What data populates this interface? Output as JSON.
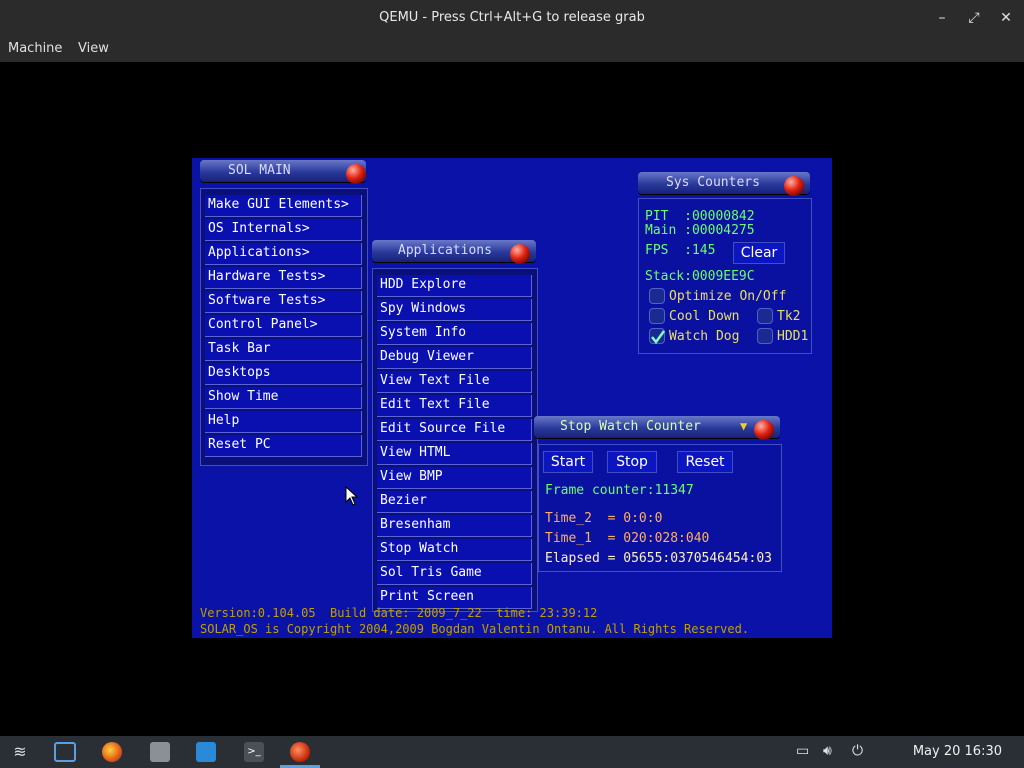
{
  "window": {
    "title": "QEMU - Press Ctrl+Alt+G to release grab",
    "menu": [
      "Machine",
      "View"
    ]
  },
  "sol_main": {
    "title": "SOL MAIN",
    "items": [
      "Make GUI Elements>",
      "OS Internals>",
      "Applications>",
      "Hardware Tests>",
      "Software Tests>",
      "Control Panel>",
      "Task Bar",
      "Desktops",
      "Show Time",
      "Help",
      "Reset PC"
    ]
  },
  "applications": {
    "title": "Applications",
    "items": [
      "HDD Explore",
      "Spy Windows",
      "System Info",
      "Debug Viewer",
      "View Text File",
      "Edit Text File",
      "Edit Source File",
      "View HTML",
      "View BMP",
      "Bezier",
      "Bresenham",
      "Stop Watch",
      "Sol Tris Game",
      "Print Screen"
    ]
  },
  "sys_counters": {
    "title": "Sys Counters",
    "pit": "PIT  :00000842",
    "main": "Main :00004275",
    "fps": "FPS  :145",
    "clear": "Clear",
    "stack": "Stack:0009EE9C",
    "checks": {
      "optimize": "Optimize On/Off",
      "cool_down": "Cool Down",
      "tk2": "Tk2",
      "watch_dog": "Watch Dog",
      "hdd1": "HDD1"
    }
  },
  "stop_watch": {
    "title": "Stop Watch Counter",
    "start": "Start",
    "stop": "Stop",
    "reset": "Reset",
    "frame_counter": "Frame counter:11347",
    "time2": "Time_2  = 0:0:0",
    "time1": "Time_1  = 020:028:040",
    "elapsed": "Elapsed = 05655:0370546454:03"
  },
  "footer": {
    "version": "Version:0.104.05  Build date: 2009_7_22  time: 23:39:12",
    "copyright": "SOLAR_OS is Copyright 2004,2009 Bogdan Valentin Ontanu. All Rights Reserved."
  },
  "taskbar": {
    "clock": "May 20  16:30"
  },
  "colors": {
    "guest_bg": "#0a12a8",
    "text_green": "#6cff6c",
    "text_orange": "#ffb060"
  }
}
